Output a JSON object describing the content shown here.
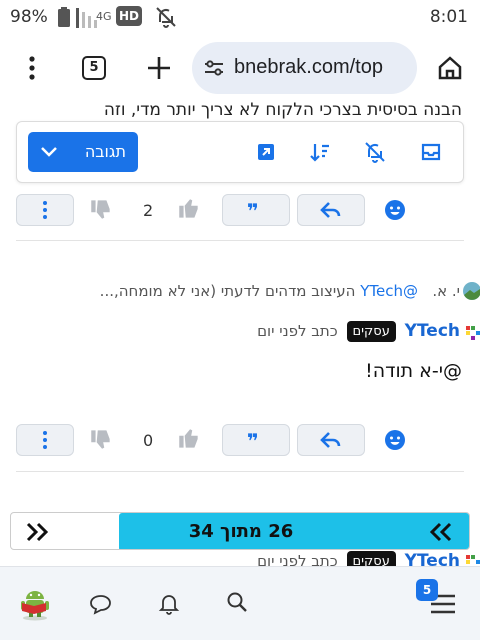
{
  "status_bar": {
    "battery_percent": "98%",
    "network": "4G",
    "hd_badge": "HD",
    "time": "8:01"
  },
  "browser": {
    "tab_count": "5",
    "url": "bnebrak.com/top"
  },
  "page": {
    "cut_off_text": "הבנה בסיסית בצרכי הלקוח לא צריך יותר מדי, וזה",
    "toolbar": {
      "reply_label": "תגובה"
    },
    "posts": [
      {
        "vote_count": "2"
      },
      {
        "quote_author": "י. א.",
        "quote_mention": "@YTech",
        "quote_text": "העיצוב מדהים לדעתי (אני לא מומחה,...",
        "author": "YTech",
        "badge": "עסקים",
        "time_ago": "כתב לפני יום",
        "body": "@י-א תודה!",
        "vote_count": "0"
      }
    ],
    "pagination": {
      "label": "26 מתוך 34",
      "progress_fraction": 0.7647
    },
    "next_post_peek": {
      "author": "YTech",
      "badge": "עסקים",
      "time_ago": "כתב לפני יום"
    }
  },
  "bottom_nav": {
    "notification_count": "5"
  },
  "colors": {
    "accent_blue": "#1a73e8",
    "pager_cyan": "#1dc0e8",
    "badge_black": "#111111"
  }
}
